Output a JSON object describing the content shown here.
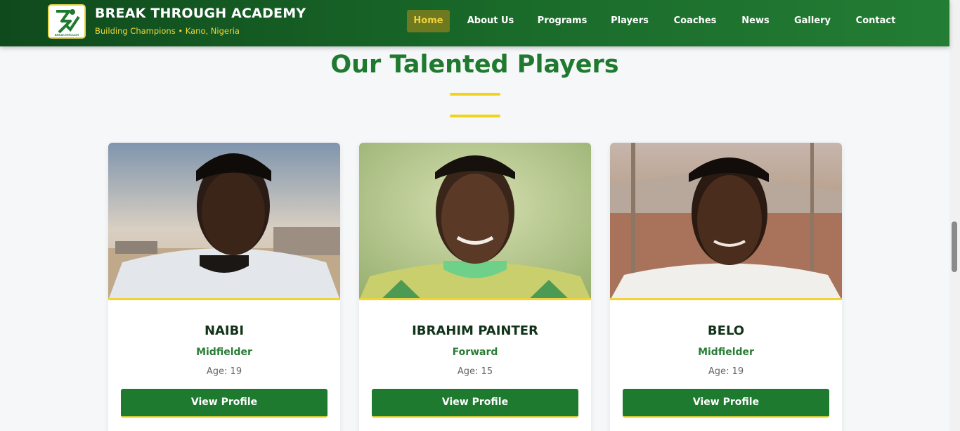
{
  "header": {
    "brand_title": "BREAK THROUGH ACADEMY",
    "brand_subtitle": "Building Champions • Kano, Nigeria",
    "logo_text": "BREAKTHROUGH",
    "nav": [
      {
        "label": "Home",
        "active": true
      },
      {
        "label": "About Us",
        "active": false
      },
      {
        "label": "Programs",
        "active": false
      },
      {
        "label": "Players",
        "active": false
      },
      {
        "label": "Coaches",
        "active": false
      },
      {
        "label": "News",
        "active": false
      },
      {
        "label": "Gallery",
        "active": false
      },
      {
        "label": "Contact",
        "active": false
      }
    ]
  },
  "section": {
    "title": "Our Talented Players"
  },
  "players": [
    {
      "name": "NAIBI",
      "position": "Midfielder",
      "age": "Age: 19",
      "button": "View Profile"
    },
    {
      "name": "IBRAHIM PAINTER",
      "position": "Forward",
      "age": "Age: 15",
      "button": "View Profile"
    },
    {
      "name": "BELO",
      "position": "Midfielder",
      "age": "Age: 19",
      "button": "View Profile"
    }
  ],
  "colors": {
    "primary_green": "#1e7a2e",
    "accent_yellow": "#f2d31b",
    "header_dark": "#0f4a1c"
  }
}
